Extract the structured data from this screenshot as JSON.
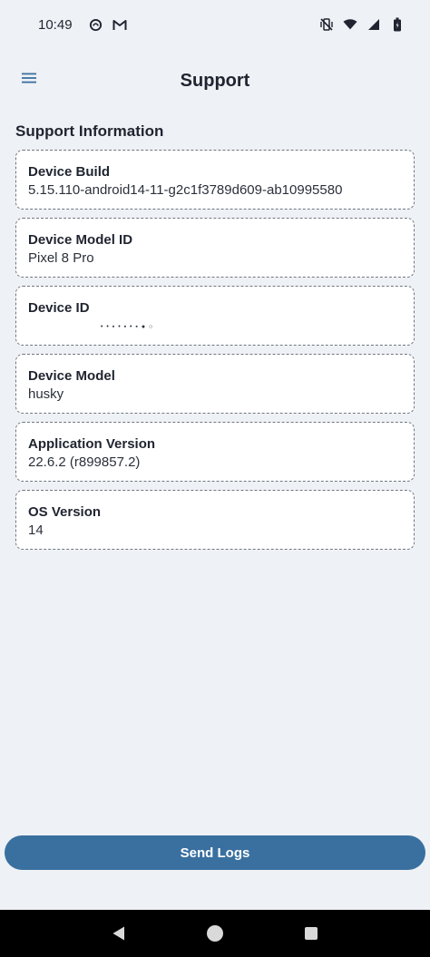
{
  "status_bar": {
    "time": "10:49",
    "left_icons": [
      "notification-circle-icon",
      "gmail-icon"
    ],
    "right_icons": [
      "vibrate-off-icon",
      "wifi-icon",
      "signal-icon",
      "battery-icon"
    ]
  },
  "app_bar": {
    "title": "Support",
    "menu_icon": "hamburger-menu-icon"
  },
  "section": {
    "title": "Support Information"
  },
  "cards": [
    {
      "label": "Device Build",
      "value": "5.15.110-android14-11-g2c1f3789d609-ab10995580"
    },
    {
      "label": "Device Model ID",
      "value": "Pixel 8 Pro"
    },
    {
      "label": "Device ID",
      "value": "• • ▪ • ▪ • ▪ ● ○"
    },
    {
      "label": "Device Model",
      "value": "husky"
    },
    {
      "label": "Application Version",
      "value": "22.6.2 (r899857.2)"
    },
    {
      "label": "OS Version",
      "value": "14"
    }
  ],
  "send_logs": {
    "label": "Send Logs"
  },
  "colors": {
    "background": "#eef1f5",
    "card_border": "#6f7680",
    "primary_button": "#3a70a0",
    "nav_bar": "#000000"
  },
  "nav_bar": {
    "icons": [
      "back-icon",
      "home-icon",
      "recents-icon"
    ]
  }
}
